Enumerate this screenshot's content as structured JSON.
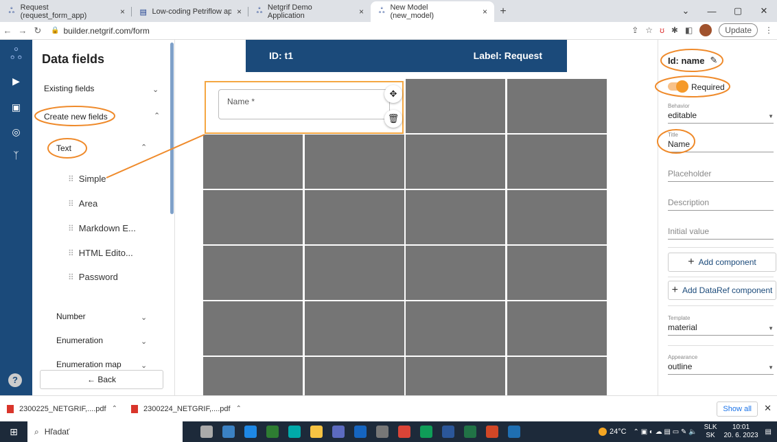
{
  "browser": {
    "tabs": [
      {
        "title": "Request (request_form_app)",
        "icon": "netgrif-logo-icon",
        "active": false
      },
      {
        "title": "Low-coding Petriflow apps in Ne",
        "icon": "document-icon",
        "active": false
      },
      {
        "title": "Netgrif Demo Application",
        "icon": "netgrif-logo-icon",
        "active": false
      },
      {
        "title": "New Model (new_model)",
        "icon": "netgrif-logo-icon",
        "active": true
      }
    ],
    "url": "builder.netgrif.com/form",
    "update_label": "Update"
  },
  "left_panel": {
    "title": "Data fields",
    "existing_fields": "Existing fields",
    "create_new_fields": "Create new fields",
    "text_group": "Text",
    "text_items": [
      "Simple",
      "Area",
      "Markdown E...",
      "HTML Edito...",
      "Password"
    ],
    "number": "Number",
    "enumeration": "Enumeration",
    "enumeration_map": "Enumeration map",
    "back_label": "← Back"
  },
  "canvas": {
    "id_label": "ID: t1",
    "label_label": "Label: Request",
    "name_field_placeholder": "Name *"
  },
  "props": {
    "id_label": "Id: name",
    "required_label": "Required",
    "behavior_label": "Behavior",
    "behavior_value": "editable",
    "title_label": "Title",
    "title_value": "Name",
    "placeholder_label": "Placeholder",
    "description_label": "Description",
    "initial_value_label": "Initial value",
    "add_component": "Add component",
    "add_dataref_component": "Add DataRef component",
    "template_label": "Template",
    "template_value": "material",
    "appearance_label": "Appearance",
    "appearance_value": "outline"
  },
  "downloads": {
    "items": [
      "2300225_NETGRIF,....pdf",
      "2300224_NETGRIF,....pdf"
    ],
    "show_all": "Show all"
  },
  "taskbar": {
    "search_placeholder": "Hľadať",
    "weather": "24°C",
    "lang_top": "SLK",
    "lang_bottom": "SK",
    "time": "10:01",
    "date": "20. 6. 2023"
  },
  "colors": {
    "primary": "#1b4a7a",
    "accent_orange": "#f59a2a",
    "grid_cell": "#757575"
  }
}
